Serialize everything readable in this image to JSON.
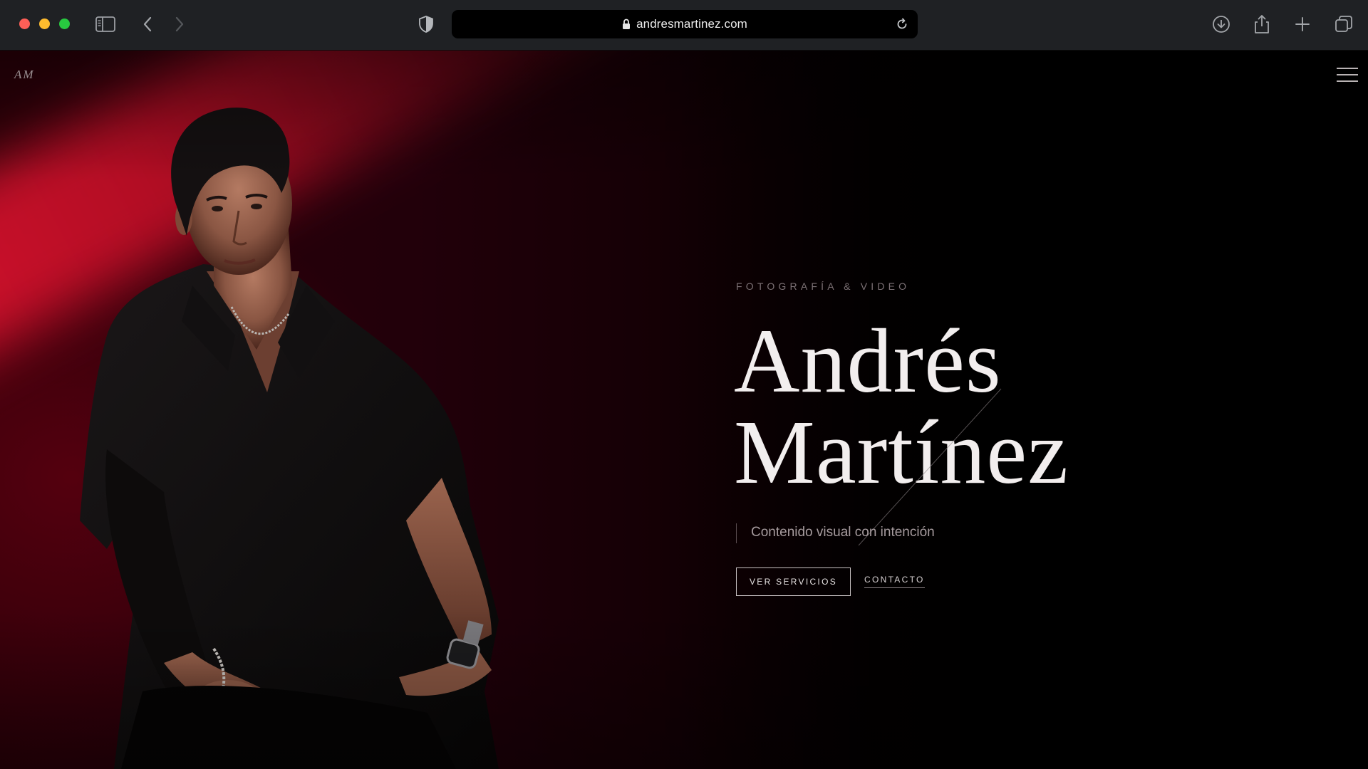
{
  "browser": {
    "url": "andresmartinez.com",
    "icons": {
      "sidebar": "sidebar-icon",
      "back": "chevron-left-icon",
      "forward": "chevron-right-icon",
      "privacy": "shield-icon",
      "lock": "lock-icon",
      "reload": "reload-icon",
      "download": "download-icon",
      "share": "share-icon",
      "new_tab": "plus-icon",
      "tabs": "tab-overview-icon"
    }
  },
  "site": {
    "logo": "AM",
    "hero": {
      "eyebrow": "FOTOGRAFÍA & VIDEO",
      "name_first": "Andrés",
      "name_last": "Martínez",
      "tagline": "Contenido visual con intención",
      "primary_cta": "VER SERVICIOS",
      "secondary_cta": "CONTACTO"
    },
    "colors": {
      "accent_red": "#e0142f",
      "background": "#000000",
      "text": "#f2eeee"
    }
  }
}
